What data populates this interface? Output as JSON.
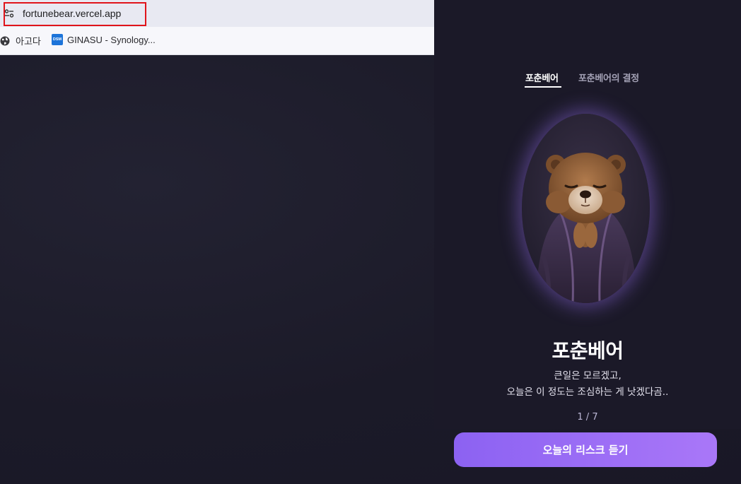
{
  "browser": {
    "url": "fortunebear.vercel.app",
    "bookmarks": [
      {
        "label": "아고다",
        "icon": "globe-icon"
      },
      {
        "label": "GINASU - Synology...",
        "icon": "dsm-icon",
        "icon_text": "DSM"
      }
    ],
    "highlight_color": "#e0141b"
  },
  "nav": {
    "tabs": [
      {
        "label": "포춘베어",
        "active": true
      },
      {
        "label": "포춘베어의 결정",
        "active": false
      }
    ]
  },
  "hero": {
    "image": "bear-monk-portrait",
    "title": "포춘베어",
    "lines": [
      "큰일은 모르겠고,",
      "오늘은 이 정도는 조심하는 게 낫겠다곰.."
    ],
    "pager": "1 / 7",
    "cta_label": "오늘의 리스크 듣기"
  },
  "colors": {
    "accent_start": "#8c62f2",
    "accent_end": "#a977f8",
    "background": "#1b1928"
  }
}
